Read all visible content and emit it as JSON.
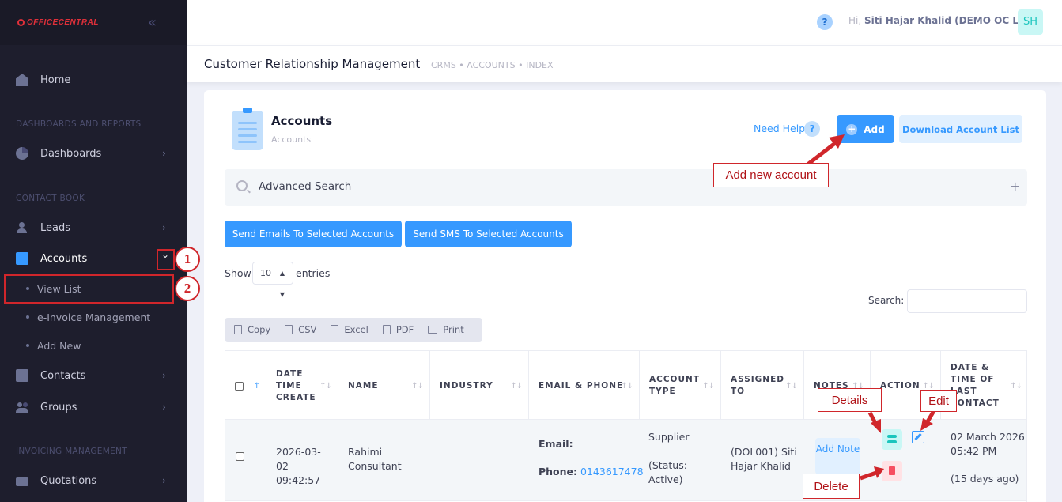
{
  "brand": {
    "logo_text": "OFFICECENTRAL",
    "collapse_icon": "double-chevron-left-icon"
  },
  "sidebar": {
    "home": "Home",
    "section_dashboards": "DASHBOARDS AND REPORTS",
    "dashboards": "Dashboards",
    "section_contact": "CONTACT BOOK",
    "leads": "Leads",
    "accounts": "Accounts",
    "sub_view_list": "View List",
    "sub_einvoice": "e-Invoice Management",
    "sub_add_new": "Add New",
    "contacts": "Contacts",
    "groups": "Groups",
    "section_invoicing": "INVOICING MANAGEMENT",
    "quotations": "Quotations",
    "arrow": "›",
    "expand_arrow": "⌄"
  },
  "topbar": {
    "help": "?",
    "greeting": "Hi,",
    "user": "Siti Hajar Khalid (DEMO OC LITE)",
    "avatar": "SH"
  },
  "subheader": {
    "title": "Customer Relationship Management",
    "breadcrumb": "CRMS  •  ACCOUNTS  •  INDEX"
  },
  "card": {
    "title": "Accounts",
    "subtitle": "Accounts",
    "need_help": "Need Help",
    "need_help_icon": "?",
    "add_label": "Add",
    "add_plus": "+",
    "download_label": "Download Account List",
    "advanced_search": "Advanced Search",
    "adv_plus": "+",
    "send_emails": "Send Emails To Selected Accounts",
    "send_sms": "Send SMS To Selected Accounts",
    "show": "Show",
    "entries_value": "10",
    "entries": "entries",
    "search_label": "Search:",
    "tools": [
      "Copy",
      "CSV",
      "Excel",
      "PDF",
      "Print"
    ]
  },
  "table": {
    "headers": {
      "date": "DATE TIME CREATE",
      "name": "NAME",
      "industry": "INDUSTRY",
      "email": "EMAIL & PHONE",
      "type": "ACCOUNT TYPE",
      "assigned": "ASSIGNED TO",
      "notes": "NOTES",
      "action": "ACTION",
      "last": "DATE & TIME OF LAST CONTACT"
    },
    "sort_icon": "↑↓",
    "row": {
      "date": "2026-03-02 09:42:57",
      "name": "Rahimi Consultant",
      "email_label": "Email:",
      "phone_label": "Phone:",
      "phone": "0143617478",
      "type": "Supplier",
      "status": "(Status: Active)",
      "assigned": "(DOL001) Siti Hajar Khalid",
      "add_note": "Add Note",
      "last_contact": "02 March 2026 05:42 PM",
      "ago": "(15 days ago)"
    }
  },
  "annotations": {
    "add_new": "Add new account",
    "details": "Details",
    "edit": "Edit",
    "delete": "Delete",
    "step1": "1",
    "step2": "2",
    "color": "#d0262b"
  }
}
